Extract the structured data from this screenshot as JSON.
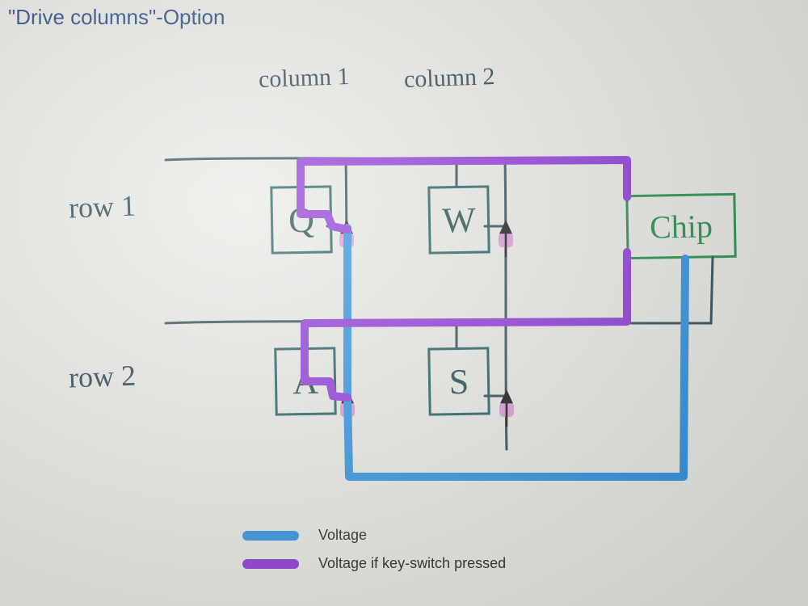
{
  "title": "\"Drive columns\"-Option",
  "columns": {
    "c1": "column 1",
    "c2": "column 2"
  },
  "rows": {
    "r1": "row 1",
    "r2": "row 2"
  },
  "keys": {
    "q": "Q",
    "w": "W",
    "a": "A",
    "s": "S"
  },
  "chip": "Chip",
  "legend": {
    "voltage": "Voltage",
    "voltage_pressed": "Voltage if key-switch pressed"
  },
  "colors": {
    "voltage": "#2a8ede",
    "voltage_pressed": "#8a32d6",
    "pen_dark": "#2a4550",
    "pen_green": "#1c8a45",
    "title": "#1a3d7a",
    "diode_pink": "#d88ad6"
  }
}
